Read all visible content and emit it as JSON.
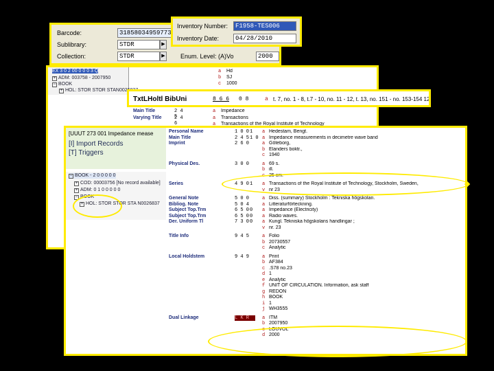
{
  "item_panel": {
    "barcode_label": "Barcode:",
    "barcode_value": "31858034959773",
    "sublibrary_label": "Sublibrary:",
    "sublibrary_value": "STDR",
    "collection_label": "Collection:",
    "collection_value": "STDR",
    "enum_label": "Enum. Level: (A)Vo",
    "enum_value": "2000"
  },
  "inventory_panel": {
    "number_label": "Inventory Number:",
    "number_value": "F1958-TES006",
    "date_label": "Inventory Date:",
    "date_value": "04/28/2010"
  },
  "back_tree": {
    "rows": [
      {
        "label": "EX 3 0 2 00 0 0 0 3 Q"
      },
      {
        "label": "ADM: 003758 - 2007950"
      },
      {
        "label": "BOOK"
      },
      {
        "label": "HOL: STOR STOR STAN0026837"
      }
    ]
  },
  "back_record": {
    "rows": [
      {
        "name": "Main Title",
        "tag": "2 4 5",
        "sub": "a",
        "value": "Impedance"
      },
      {
        "name": "Varying Title",
        "tag": "2 4 6",
        "sub": "a",
        "value": "Transactions"
      },
      {
        "name": "",
        "tag": "",
        "sub": "a",
        "value": "Transactions of the Royal Institute of Technology"
      }
    ],
    "top_rows": [
      {
        "sub": "a",
        "value": "Hd"
      },
      {
        "sub": "b",
        "value": "SJ"
      },
      {
        "sub": "c",
        "value": "1000"
      }
    ]
  },
  "bib_banner": {
    "title": "TxtLHoltl BibUni",
    "tag": "8 6 6",
    "ind": "0 8",
    "sub": "a",
    "value": "t. 7, no. 1 - 8, t.7 - 10, no. 11 - 12, t. 13, no. 151 - no. 153-154 12"
  },
  "front_tree": {
    "top_items": [
      {
        "label": "[UUUT 273 001 Impedance mease"
      },
      {
        "label": "[I] Import Records"
      },
      {
        "label": "[T] Triggers"
      }
    ],
    "bottom_items": [
      {
        "label": "BOOK - 2 0 0 0 0 0"
      },
      {
        "label": "COD: 00003756 [No record available]"
      },
      {
        "label": "ADM: 0 1 0 0 0 0 0"
      },
      {
        "label": "BOOK"
      },
      {
        "label": "HOL: STOR STOR STA N0026837"
      }
    ]
  },
  "front_record": {
    "fields": [
      {
        "name": "Personal Name",
        "tag": "1 0 0",
        "ind": "1",
        "subs": [
          {
            "s": "a",
            "v": "Hedestam, Bengt."
          }
        ]
      },
      {
        "name": "Main Title",
        "tag": "2 4 5",
        "ind": "1 0",
        "subs": [
          {
            "s": "a",
            "v": "Impedance measurements in decimetre wave band"
          }
        ]
      },
      {
        "name": "Imprint",
        "tag": "2 6 0",
        "ind": "",
        "subs": [
          {
            "s": "a",
            "v": "Göteborg,"
          },
          {
            "s": "b",
            "v": "Elanders boktr.,"
          },
          {
            "s": "c",
            "v": "1940"
          }
        ]
      },
      {
        "name": "Physical Des.",
        "tag": "3 0 0",
        "ind": "",
        "subs": [
          {
            "s": "a",
            "v": "69 s."
          },
          {
            "s": "b",
            "v": "ill."
          },
          {
            "s": "c",
            "v": "25 cm."
          }
        ]
      },
      {
        "name": "Series",
        "tag": "4 9 0",
        "ind": "1",
        "subs": [
          {
            "s": "a",
            "v": "Transactions of the Royal Institute of Technology, Stockholm, Sweden,"
          },
          {
            "s": "v",
            "v": "nr 23"
          }
        ]
      },
      {
        "name": "General Note",
        "tag": "5 0 0",
        "ind": "",
        "subs": [
          {
            "s": "a",
            "v": "Diss. (summary) Stockholm : Tekniska högskolan."
          }
        ]
      },
      {
        "name": "Bibliog. Note",
        "tag": "5 0 4",
        "ind": "",
        "subs": [
          {
            "s": "a",
            "v": "Litteraturförteckning."
          }
        ]
      },
      {
        "name": "Subject Top.Trm",
        "tag": "6 5 0",
        "ind": "0",
        "subs": [
          {
            "s": "a",
            "v": "Impedance (Electricity)"
          }
        ]
      },
      {
        "name": "Subject Top.Trm",
        "tag": "6 5 0",
        "ind": "0",
        "subs": [
          {
            "s": "a",
            "v": "Radio waves."
          }
        ]
      },
      {
        "name": "Der. Uniform Tl",
        "tag": "7 3 0",
        "ind": "0",
        "subs": [
          {
            "s": "a",
            "v": "Kungl. Tekniska högskolans handlingar ;"
          },
          {
            "s": "v",
            "v": "nr. 23"
          }
        ]
      },
      {
        "name": "Title Info",
        "tag": "9 4 5",
        "ind": "",
        "subs": [
          {
            "s": "a",
            "v": "Folio"
          },
          {
            "s": "b",
            "v": "20730557"
          },
          {
            "s": "c",
            "v": "Analytic"
          }
        ]
      },
      {
        "name": "Local Holdstem",
        "tag": "9 4 9",
        "ind": "",
        "subs": [
          {
            "s": "a",
            "v": "Print"
          },
          {
            "s": "b",
            "v": "AF384"
          },
          {
            "s": "c",
            "v": ".S78 no.23"
          },
          {
            "s": "d",
            "v": "1"
          },
          {
            "s": "e",
            "v": "Analytic"
          },
          {
            "s": "f",
            "v": "UNIT OF CIRCULATION. Information, ask staff"
          },
          {
            "s": "g",
            "v": "REDON"
          },
          {
            "s": "h",
            "v": "BOOK"
          },
          {
            "s": "i",
            "v": "1"
          },
          {
            "s": "j",
            "v": "WH3555"
          }
        ]
      },
      {
        "name": "Dual Linkage",
        "tag": "L K R",
        "ind": "",
        "subs": [
          {
            "s": "a",
            "v": "ITM"
          },
          {
            "s": "b",
            "v": "2007950"
          },
          {
            "s": "c",
            "v": "LOUVOL"
          },
          {
            "s": "d",
            "v": "2000"
          }
        ]
      }
    ]
  },
  "colors": {
    "highlight": "#ffeb00",
    "subfield": "#b01919",
    "field_name": "#1d2c7a",
    "selection": "#2f58b8"
  }
}
